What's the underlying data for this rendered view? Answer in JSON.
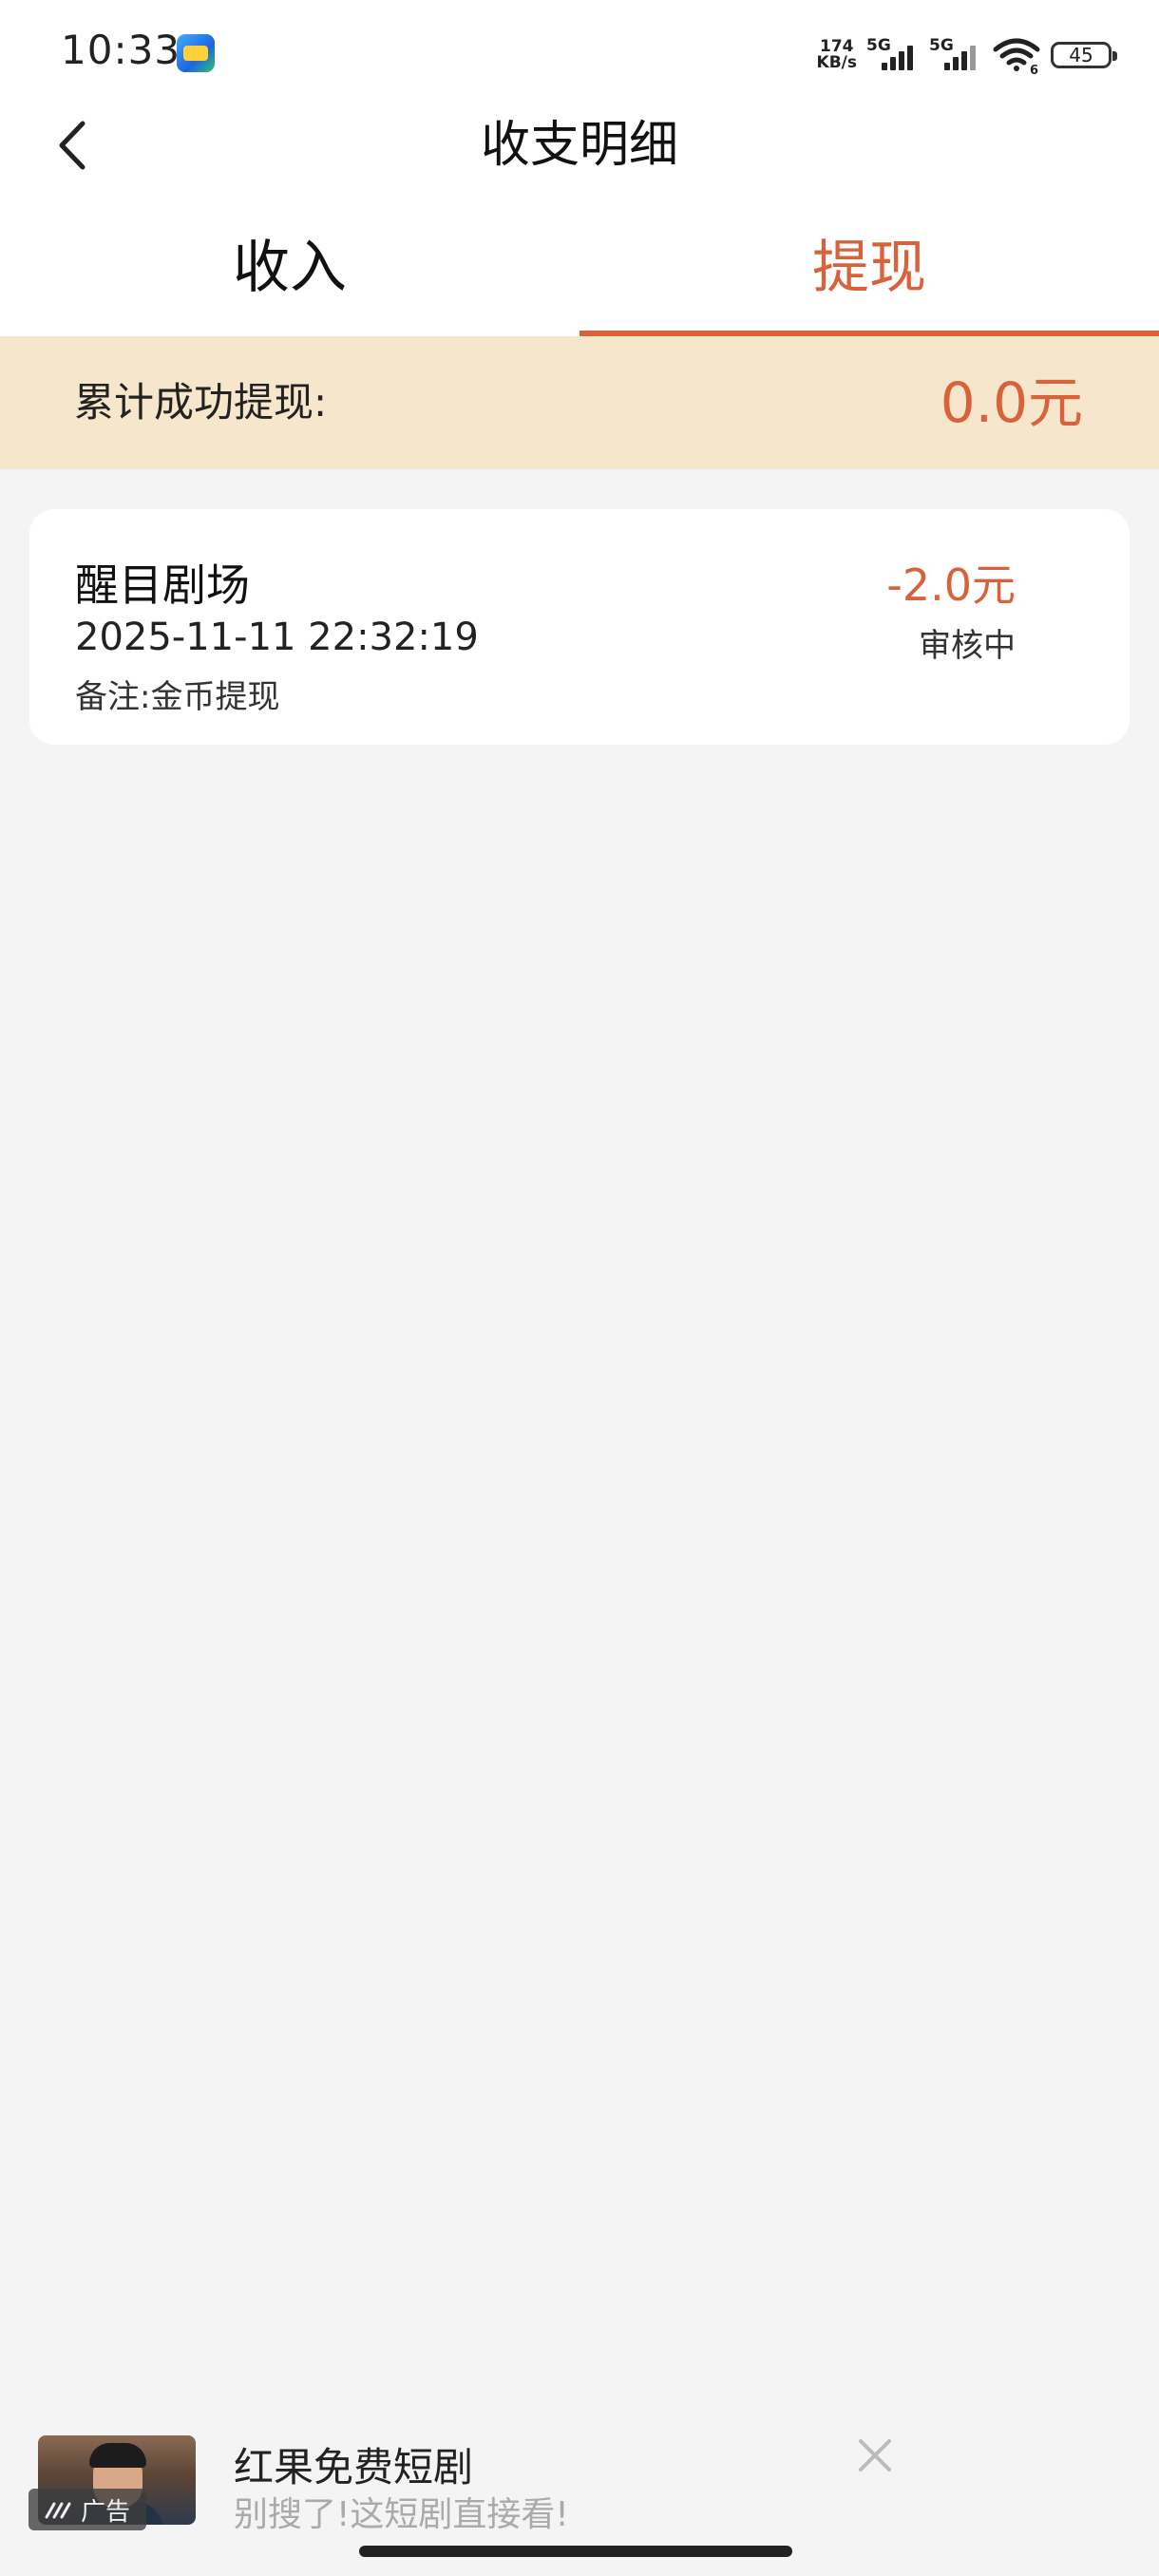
{
  "status_bar": {
    "time": "10:33",
    "net_speed_value": "174",
    "net_speed_unit": "KB/s",
    "sim1_tag": "5G",
    "sim2_tag": "5G",
    "wifi_tag": "6",
    "battery": "45"
  },
  "nav": {
    "title": "收支明细",
    "back_icon": "chevron-left-icon"
  },
  "tabs": [
    {
      "label": "收入",
      "active": false
    },
    {
      "label": "提现",
      "active": true
    }
  ],
  "summary": {
    "label": "累计成功提现:",
    "value": "0.0元"
  },
  "records": [
    {
      "title": "醒目剧场",
      "time": "2025-11-11 22:32:19",
      "note": "备注:金币提现",
      "amount": "-2.0元",
      "status": "审核中"
    }
  ],
  "ad": {
    "title": "红果免费短剧",
    "subtitle": "别搜了!这短剧直接看!",
    "badge": "广告",
    "close_icon": "close-icon"
  },
  "colors": {
    "accent": "#d8623a",
    "summary_bg": "#f6e6cc",
    "page_bg": "#f4f4f4"
  }
}
